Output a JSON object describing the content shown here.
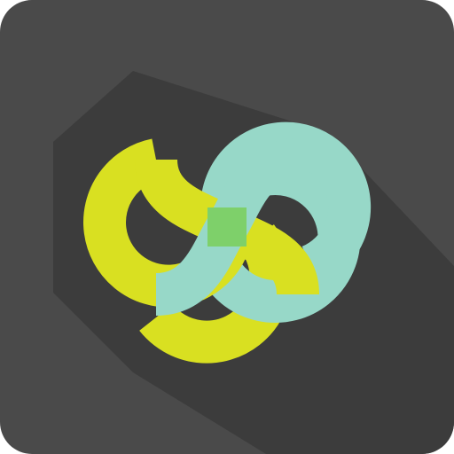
{
  "icon": {
    "name": "interlocking-rings-logo-icon",
    "colors": {
      "background": "#4a4a4a",
      "shadow": "#3c3c3c",
      "yellow_ring": "#d9e021",
      "teal_ring": "#97d8c8",
      "overlap": "#7ed06a"
    }
  }
}
